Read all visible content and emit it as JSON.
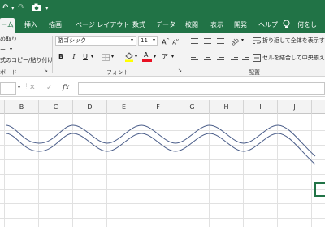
{
  "titlebar": {
    "undo_icon": "undo-arrow-icon",
    "camera_icon": "camera-icon",
    "qat_dropdown": "▾"
  },
  "menu": {
    "tabs": [
      "ーム",
      "挿入",
      "描画",
      "ページ レイアウト",
      "数式",
      "データ",
      "校閲",
      "表示",
      "開発",
      "ヘルプ",
      "何をし"
    ],
    "lightbulb_icon": "lightbulb-icon"
  },
  "ribbon": {
    "clipboard": {
      "cut": "め取り",
      "copy": "ー",
      "paste_format": "式のコピー/貼り付け",
      "group_label": "ボード"
    },
    "font": {
      "name": "游ゴシック",
      "size": "11",
      "grow": "A",
      "shrink": "A",
      "bold": "B",
      "italic": "I",
      "underline": "U",
      "font_color": "A",
      "phonetic": "ア",
      "group_label": "フォント"
    },
    "alignment": {
      "wrap_text": "折り返して全体を表示する",
      "merge_center": "セルを結合して中央揃え",
      "group_label": "配置"
    }
  },
  "formula_bar": {
    "cancel": "✕",
    "enter": "✓",
    "fx": "fx",
    "value": ""
  },
  "sheet": {
    "columns": [
      "B",
      "C",
      "D",
      "E",
      "F",
      "G",
      "H",
      "I",
      "J"
    ],
    "line_color": "#4a5d89",
    "accent": "#217346"
  }
}
